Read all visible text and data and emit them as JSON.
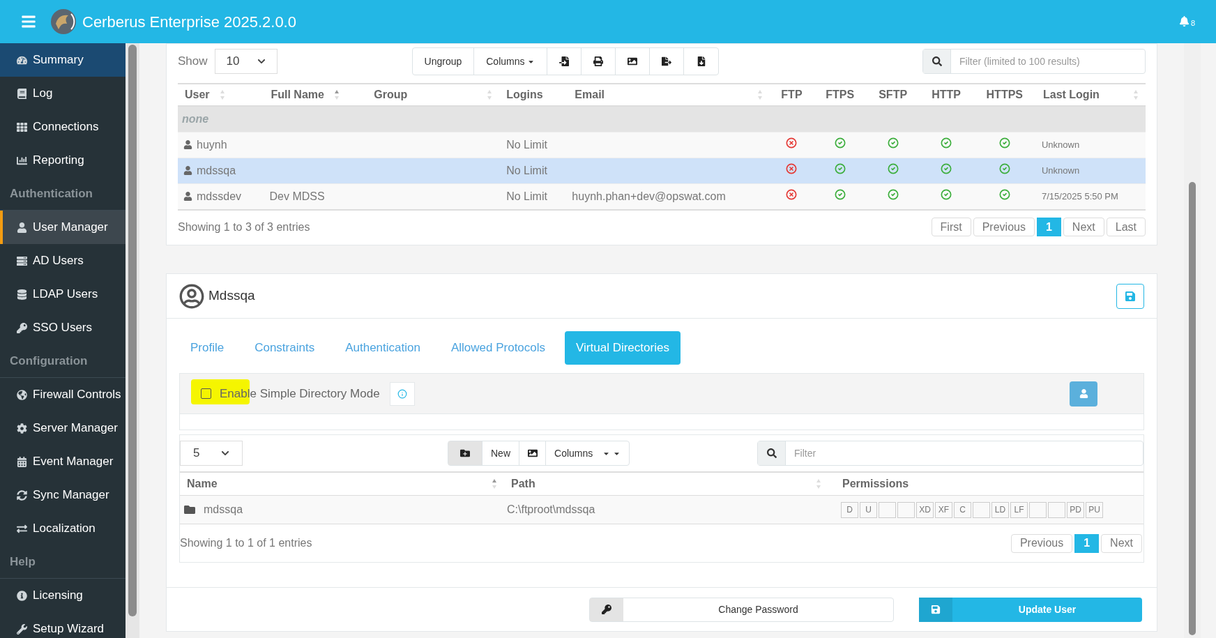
{
  "header": {
    "title": "Cerberus Enterprise 2025.2.0.0",
    "notifications": "8"
  },
  "sidebar": {
    "sections": [
      {
        "items": [
          {
            "label": "Summary",
            "selected": false,
            "highlighted": true
          },
          {
            "label": "Log",
            "selected": false,
            "highlighted": false
          },
          {
            "label": "Connections",
            "selected": false,
            "highlighted": false
          },
          {
            "label": "Reporting",
            "selected": false,
            "highlighted": false
          }
        ]
      },
      {
        "heading": "Authentication",
        "items": [
          {
            "label": "User Manager",
            "selected": true,
            "highlighted": false
          },
          {
            "label": "AD Users",
            "selected": false,
            "highlighted": false
          },
          {
            "label": "LDAP Users",
            "selected": false,
            "highlighted": false
          },
          {
            "label": "SSO Users",
            "selected": false,
            "highlighted": false
          }
        ]
      },
      {
        "heading": "Configuration",
        "items": [
          {
            "label": "Firewall Controls",
            "selected": false,
            "highlighted": false
          },
          {
            "label": "Server Manager",
            "selected": false,
            "highlighted": false
          },
          {
            "label": "Event Manager",
            "selected": false,
            "highlighted": false
          },
          {
            "label": "Sync Manager",
            "selected": false,
            "highlighted": false
          },
          {
            "label": "Localization",
            "selected": false,
            "highlighted": false
          }
        ]
      },
      {
        "heading": "Help",
        "items": [
          {
            "label": "Licensing",
            "selected": false,
            "highlighted": false
          },
          {
            "label": "Setup Wizard",
            "selected": false,
            "highlighted": false
          }
        ]
      }
    ]
  },
  "users_table": {
    "show_label": "Show",
    "page_size": "10",
    "toolbar": [
      "Ungroup",
      "Columns"
    ],
    "filter_placeholder": "Filter (limited to 100 results)",
    "columns": [
      "User",
      "Full Name",
      "Group",
      "Logins",
      "Email",
      "FTP",
      "FTPS",
      "SFTP",
      "HTTP",
      "HTTPS",
      "Last Login"
    ],
    "group": "none",
    "rows": [
      {
        "user": "huynh",
        "full_name": "",
        "logins": "No Limit",
        "email": "",
        "protocols": [
          false,
          true,
          true,
          true,
          true
        ],
        "last_login": "Unknown",
        "selected": false
      },
      {
        "user": "mdssqa",
        "full_name": "",
        "logins": "No Limit",
        "email": "",
        "protocols": [
          false,
          true,
          true,
          true,
          true
        ],
        "last_login": "Unknown",
        "selected": true
      },
      {
        "user": "mdssdev",
        "full_name": "Dev MDSS",
        "logins": "No Limit",
        "email": "huynh.phan+dev@opswat.com",
        "protocols": [
          false,
          true,
          true,
          true,
          true
        ],
        "last_login": "7/15/2025 5:50 PM",
        "selected": false
      }
    ],
    "info": "Showing 1 to 3 of 3 entries",
    "pagination": [
      {
        "label": "First",
        "selected": false
      },
      {
        "label": "Previous",
        "selected": false
      },
      {
        "label": "1",
        "selected": true
      },
      {
        "label": "Next",
        "selected": false
      },
      {
        "label": "Last",
        "selected": false
      }
    ]
  },
  "user_panel": {
    "name": "Mdssqa",
    "tabs": [
      {
        "label": "Profile",
        "selected": false
      },
      {
        "label": "Constraints",
        "selected": false
      },
      {
        "label": "Authentication",
        "selected": false
      },
      {
        "label": "Allowed Protocols",
        "selected": false
      },
      {
        "label": "Virtual Directories",
        "selected": true
      }
    ],
    "simple_mode": {
      "label": "Enable Simple Directory Mode",
      "checked": false
    },
    "dirs": {
      "page_size": "5",
      "toolbar": [
        "New",
        "Columns"
      ],
      "filter_placeholder": "Filter",
      "columns": [
        "Name",
        "Path",
        "Permissions"
      ],
      "rows": [
        {
          "name": "mdssqa",
          "path": "C:\\ftproot\\mdssqa",
          "permissions": [
            {
              "kind": "flag",
              "label": "D"
            },
            {
              "kind": "flag",
              "label": "U"
            },
            {
              "kind": "empty"
            },
            {
              "kind": "empty"
            },
            {
              "kind": "flag",
              "label": "XD"
            },
            {
              "kind": "flag",
              "label": "XF"
            },
            {
              "kind": "flag",
              "label": "C"
            },
            {
              "kind": "empty"
            },
            {
              "kind": "flag",
              "label": "LD"
            },
            {
              "kind": "flag",
              "label": "LF"
            },
            {
              "kind": "empty"
            },
            {
              "kind": "empty"
            },
            {
              "kind": "flag",
              "label": "PD"
            },
            {
              "kind": "flag",
              "label": "PU"
            }
          ]
        }
      ],
      "info": "Showing 1 to 1 of 1 entries",
      "pagination": [
        {
          "label": "Previous",
          "selected": false
        },
        {
          "label": "1",
          "selected": true
        },
        {
          "label": "Next",
          "selected": false
        }
      ]
    },
    "buttons": [
      "Change Password",
      "Update User"
    ]
  }
}
